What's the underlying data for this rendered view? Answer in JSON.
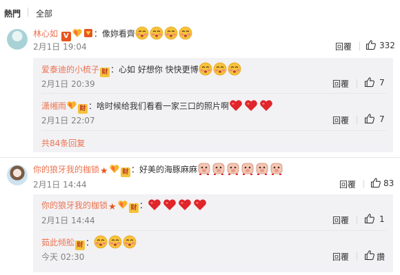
{
  "filters": {
    "hot": "熱門",
    "all": "全部"
  },
  "comments": [
    {
      "user": "林心如",
      "sep": "：",
      "text": "像妳看齊",
      "time": "2月1日 19:04",
      "reply_label": "回覆",
      "likes": "332",
      "replies": [
        {
          "user": "爱泰迪的小梳子",
          "sep": "：",
          "text": "心如 好想你  快快更博",
          "time": "2月1日 20:39",
          "reply_label": "回覆",
          "likes": "7"
        },
        {
          "user": "潇缃雨",
          "sep": "：",
          "text": "啥时候给我们看看一家三口的照片啊",
          "time": "2月1日 22:07",
          "reply_label": "回覆",
          "likes": "7"
        }
      ],
      "more": "共84条回复"
    },
    {
      "user": "你的狼牙我的枷锁",
      "sep": "：",
      "text": "好美的海豚麻麻",
      "time": "2月1日 14:44",
      "reply_label": "回覆",
      "likes": "83",
      "replies": [
        {
          "user": "你的狼牙我的枷锁",
          "sep": "：",
          "text": "",
          "time": "2月1日 14:44",
          "reply_label": "回覆",
          "likes": "1"
        },
        {
          "user": "茹此倾舩",
          "sep": "：",
          "text": "",
          "time": "今天 02:30",
          "reply_label": "回覆",
          "likes": "讚"
        }
      ]
    }
  ],
  "icons": {
    "badge_v": "V",
    "badge_cai": "财"
  },
  "colors": {
    "username": "#eb7350",
    "reply_bg": "#f2f2f5",
    "heart": "#e0262b"
  }
}
